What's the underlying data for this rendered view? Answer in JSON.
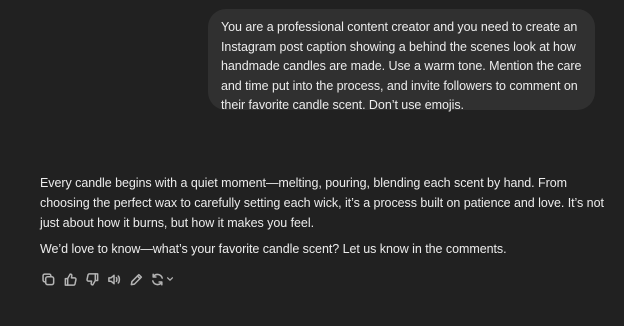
{
  "user_message": {
    "text": "You are a professional content creator and you need to create an Instagram post caption showing a behind the scenes look at how handmade candles are made. Use a warm tone. Mention the care and time put into the process, and invite followers to comment on their favorite candle scent. Don’t use emojis."
  },
  "assistant_message": {
    "paragraphs": [
      "Every candle begins with a quiet moment—melting, pouring, blending each scent by hand. From choosing the perfect wax to carefully setting each wick, it’s a process built on patience and love. It’s not just about how it burns, but how it makes you feel.",
      "We’d love to know—what’s your favorite candle scent? Let us know in the comments."
    ]
  },
  "action_bar": {
    "icons": [
      "copy-icon",
      "thumbs-up-icon",
      "thumbs-down-icon",
      "read-aloud-icon",
      "edit-icon",
      "regenerate-icon",
      "chevron-down-icon"
    ]
  },
  "colors": {
    "background": "#212121",
    "user_bubble": "#303030",
    "text": "#ececec",
    "icon": "#b4b4b4"
  }
}
